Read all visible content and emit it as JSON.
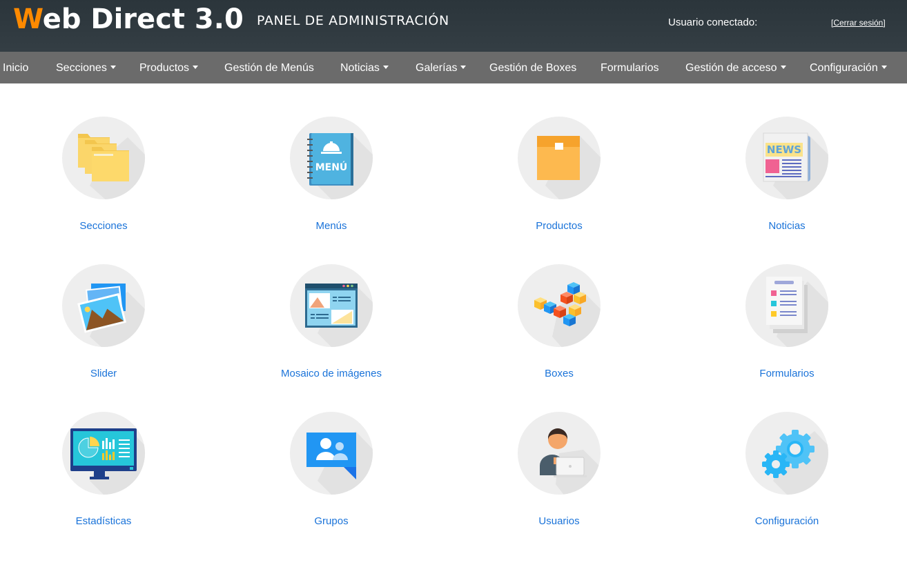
{
  "header": {
    "logo_initial": "W",
    "logo_rest": "eb Direct 3.0",
    "panel_title": "PANEL DE ADMINISTRACIÓN",
    "user_label": "Usuario conectado:",
    "logout_label": "[Cerrar sesión]"
  },
  "nav": {
    "items": [
      {
        "label": "Inicio",
        "dropdown": false
      },
      {
        "label": "Secciones",
        "dropdown": true
      },
      {
        "label": "Productos",
        "dropdown": true
      },
      {
        "label": "Gestión de Menús",
        "dropdown": false
      },
      {
        "label": "Noticias",
        "dropdown": true
      },
      {
        "label": "Galerías",
        "dropdown": true
      },
      {
        "label": "Gestión de Boxes",
        "dropdown": false
      },
      {
        "label": "Formularios",
        "dropdown": false
      },
      {
        "label": "Gestión de acceso",
        "dropdown": true
      },
      {
        "label": "Configuración",
        "dropdown": true
      }
    ]
  },
  "tiles": [
    {
      "label": "Secciones",
      "icon": "folders-icon"
    },
    {
      "label": "Menús",
      "icon": "menu-book-icon",
      "icon_text": "MENÚ"
    },
    {
      "label": "Productos",
      "icon": "box-icon"
    },
    {
      "label": "Noticias",
      "icon": "newspaper-icon",
      "icon_text": "NEWS"
    },
    {
      "label": "Slider",
      "icon": "photos-icon"
    },
    {
      "label": "Mosaico de imágenes",
      "icon": "mosaic-icon"
    },
    {
      "label": "Boxes",
      "icon": "cubes-icon"
    },
    {
      "label": "Formularios",
      "icon": "forms-icon"
    },
    {
      "label": "Estadísticas",
      "icon": "stats-monitor-icon"
    },
    {
      "label": "Grupos",
      "icon": "groups-icon"
    },
    {
      "label": "Usuarios",
      "icon": "user-laptop-icon"
    },
    {
      "label": "Configuración",
      "icon": "gears-icon"
    }
  ],
  "colors": {
    "header_bg": "#2b353b",
    "nav_bg": "#6b6b6b",
    "logo_accent": "#ff8a00",
    "link": "#1a73d9",
    "circle_bg": "#eeeeee"
  }
}
